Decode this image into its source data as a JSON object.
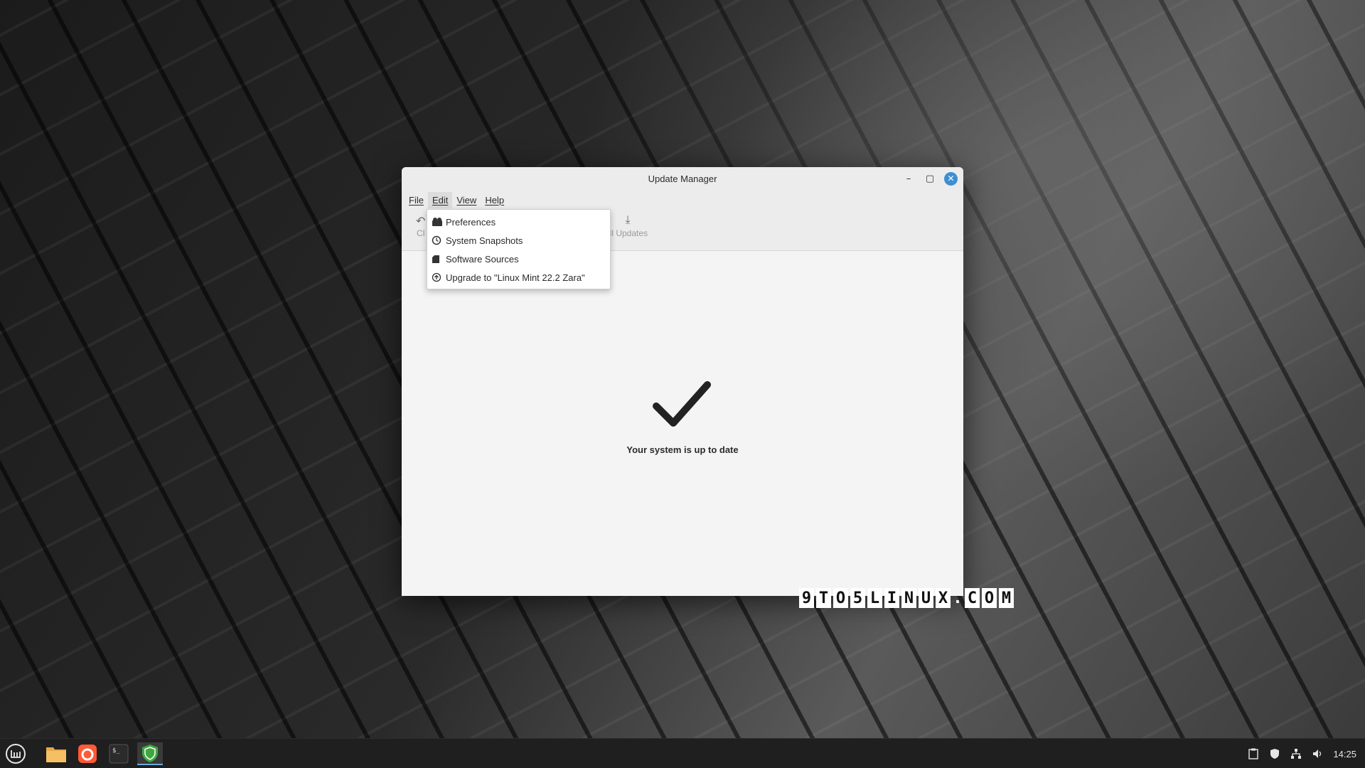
{
  "window": {
    "title": "Update Manager",
    "minimize_glyph": "–",
    "maximize_glyph": "▢",
    "close_glyph": "✕"
  },
  "menubar": {
    "items": [
      "File",
      "Edit",
      "View",
      "Help"
    ],
    "active": "Edit"
  },
  "toolbar": {
    "left_partial_label": "Cl",
    "install_label": "ill Updates"
  },
  "edit_menu": {
    "items": [
      {
        "label": "Preferences",
        "icon": "preferences-icon"
      },
      {
        "label": "System Snapshots",
        "icon": "snapshot-clock-icon"
      },
      {
        "label": "Software Sources",
        "icon": "package-icon"
      },
      {
        "label": "Upgrade to \"Linux Mint 22.2 Zara\"",
        "icon": "upgrade-arrow-icon"
      }
    ]
  },
  "main": {
    "status": "Your system is up to date"
  },
  "watermark": [
    "9",
    "T",
    "O",
    "5",
    "L",
    "I",
    "N",
    "U",
    "X",
    ".",
    "C",
    "O",
    "M"
  ],
  "taskbar": {
    "apps": [
      "mint-menu-icon",
      "files-icon",
      "firefox-icon",
      "terminal-icon",
      "update-manager-shield-icon"
    ],
    "clock": "14:25"
  },
  "colors": {
    "accent": "#3d8fd1",
    "window_bg": "#f4f4f4",
    "taskbar_bg": "#1f1f1f",
    "shield_green": "#3fa73f"
  }
}
